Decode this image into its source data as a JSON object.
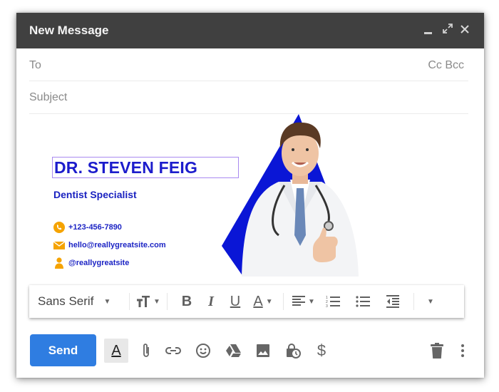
{
  "window": {
    "title": "New Message",
    "controls": {
      "minimize": "minimize",
      "expand": "expand",
      "close": "close"
    }
  },
  "fields": {
    "to_label": "To",
    "to_value": "",
    "cc_label": "Cc",
    "bcc_label": "Bcc",
    "subject_placeholder": "Subject",
    "subject_value": ""
  },
  "signature": {
    "name": "DR. STEVEN FEIG",
    "role": "Dentist Specialist",
    "phone": "+123-456-7890",
    "email": "hello@reallygreatsite.com",
    "social": "@reallygreatsite",
    "accent_color": "#1c1ccc",
    "icon_color": "#f5a300",
    "photo_alt": "Smiling doctor in white coat with stethoscope giving thumbs up"
  },
  "format_toolbar": {
    "font_family": "Sans Serif",
    "items": [
      "font-size",
      "bold",
      "italic",
      "underline",
      "text-color",
      "align",
      "numbered-list",
      "bulleted-list",
      "indent-less",
      "more-formatting"
    ],
    "bold_label": "B",
    "italic_label": "I",
    "underline_label": "U",
    "text_color_label": "A"
  },
  "bottom_bar": {
    "send_label": "Send",
    "format_toggle_label": "A",
    "send_color": "#2f7de1",
    "icons": [
      "attach-file",
      "insert-link",
      "insert-emoji",
      "google-drive",
      "insert-photo",
      "confidential-mode",
      "insert-money",
      "discard",
      "more-options"
    ]
  }
}
